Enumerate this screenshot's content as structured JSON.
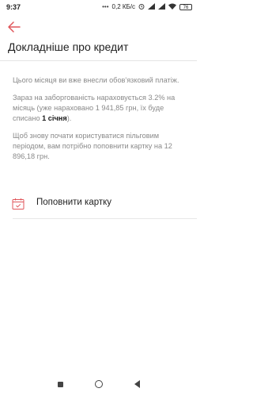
{
  "status_bar": {
    "time": "9:37",
    "dots": "•••",
    "network_speed": "0,2 КБ/с",
    "battery": "76",
    "icons": [
      "alarm-icon",
      "signal-icon",
      "signal-icon",
      "wifi-icon",
      "battery-icon"
    ]
  },
  "header": {
    "back_icon": "arrow-left-icon",
    "title": "Докладніше про кредит"
  },
  "info": {
    "paragraph1": "Цього місяця ви вже внесли обов'язковий платіж.",
    "paragraph2_text": "Зараз на заборгованість нараховується 3.2% на місяць (уже нараховано 1 941,85 грн, їх буде списано ",
    "paragraph2_bold": "1 січня",
    "paragraph2_end": ").",
    "paragraph3": "Щоб знову почати користуватися пільговим періодом, вам потрібно поповнити картку на 12 896,18 грн."
  },
  "action": {
    "icon": "calendar-check-icon",
    "label": "Поповнити картку"
  },
  "nav": {
    "items": [
      "recents-square-icon",
      "home-circle-icon",
      "back-triangle-icon"
    ]
  },
  "colors": {
    "accent": "#e0565b",
    "text_primary": "#1f1f1f",
    "text_secondary": "#8a8a8a",
    "divider": "#e4e4e4"
  }
}
